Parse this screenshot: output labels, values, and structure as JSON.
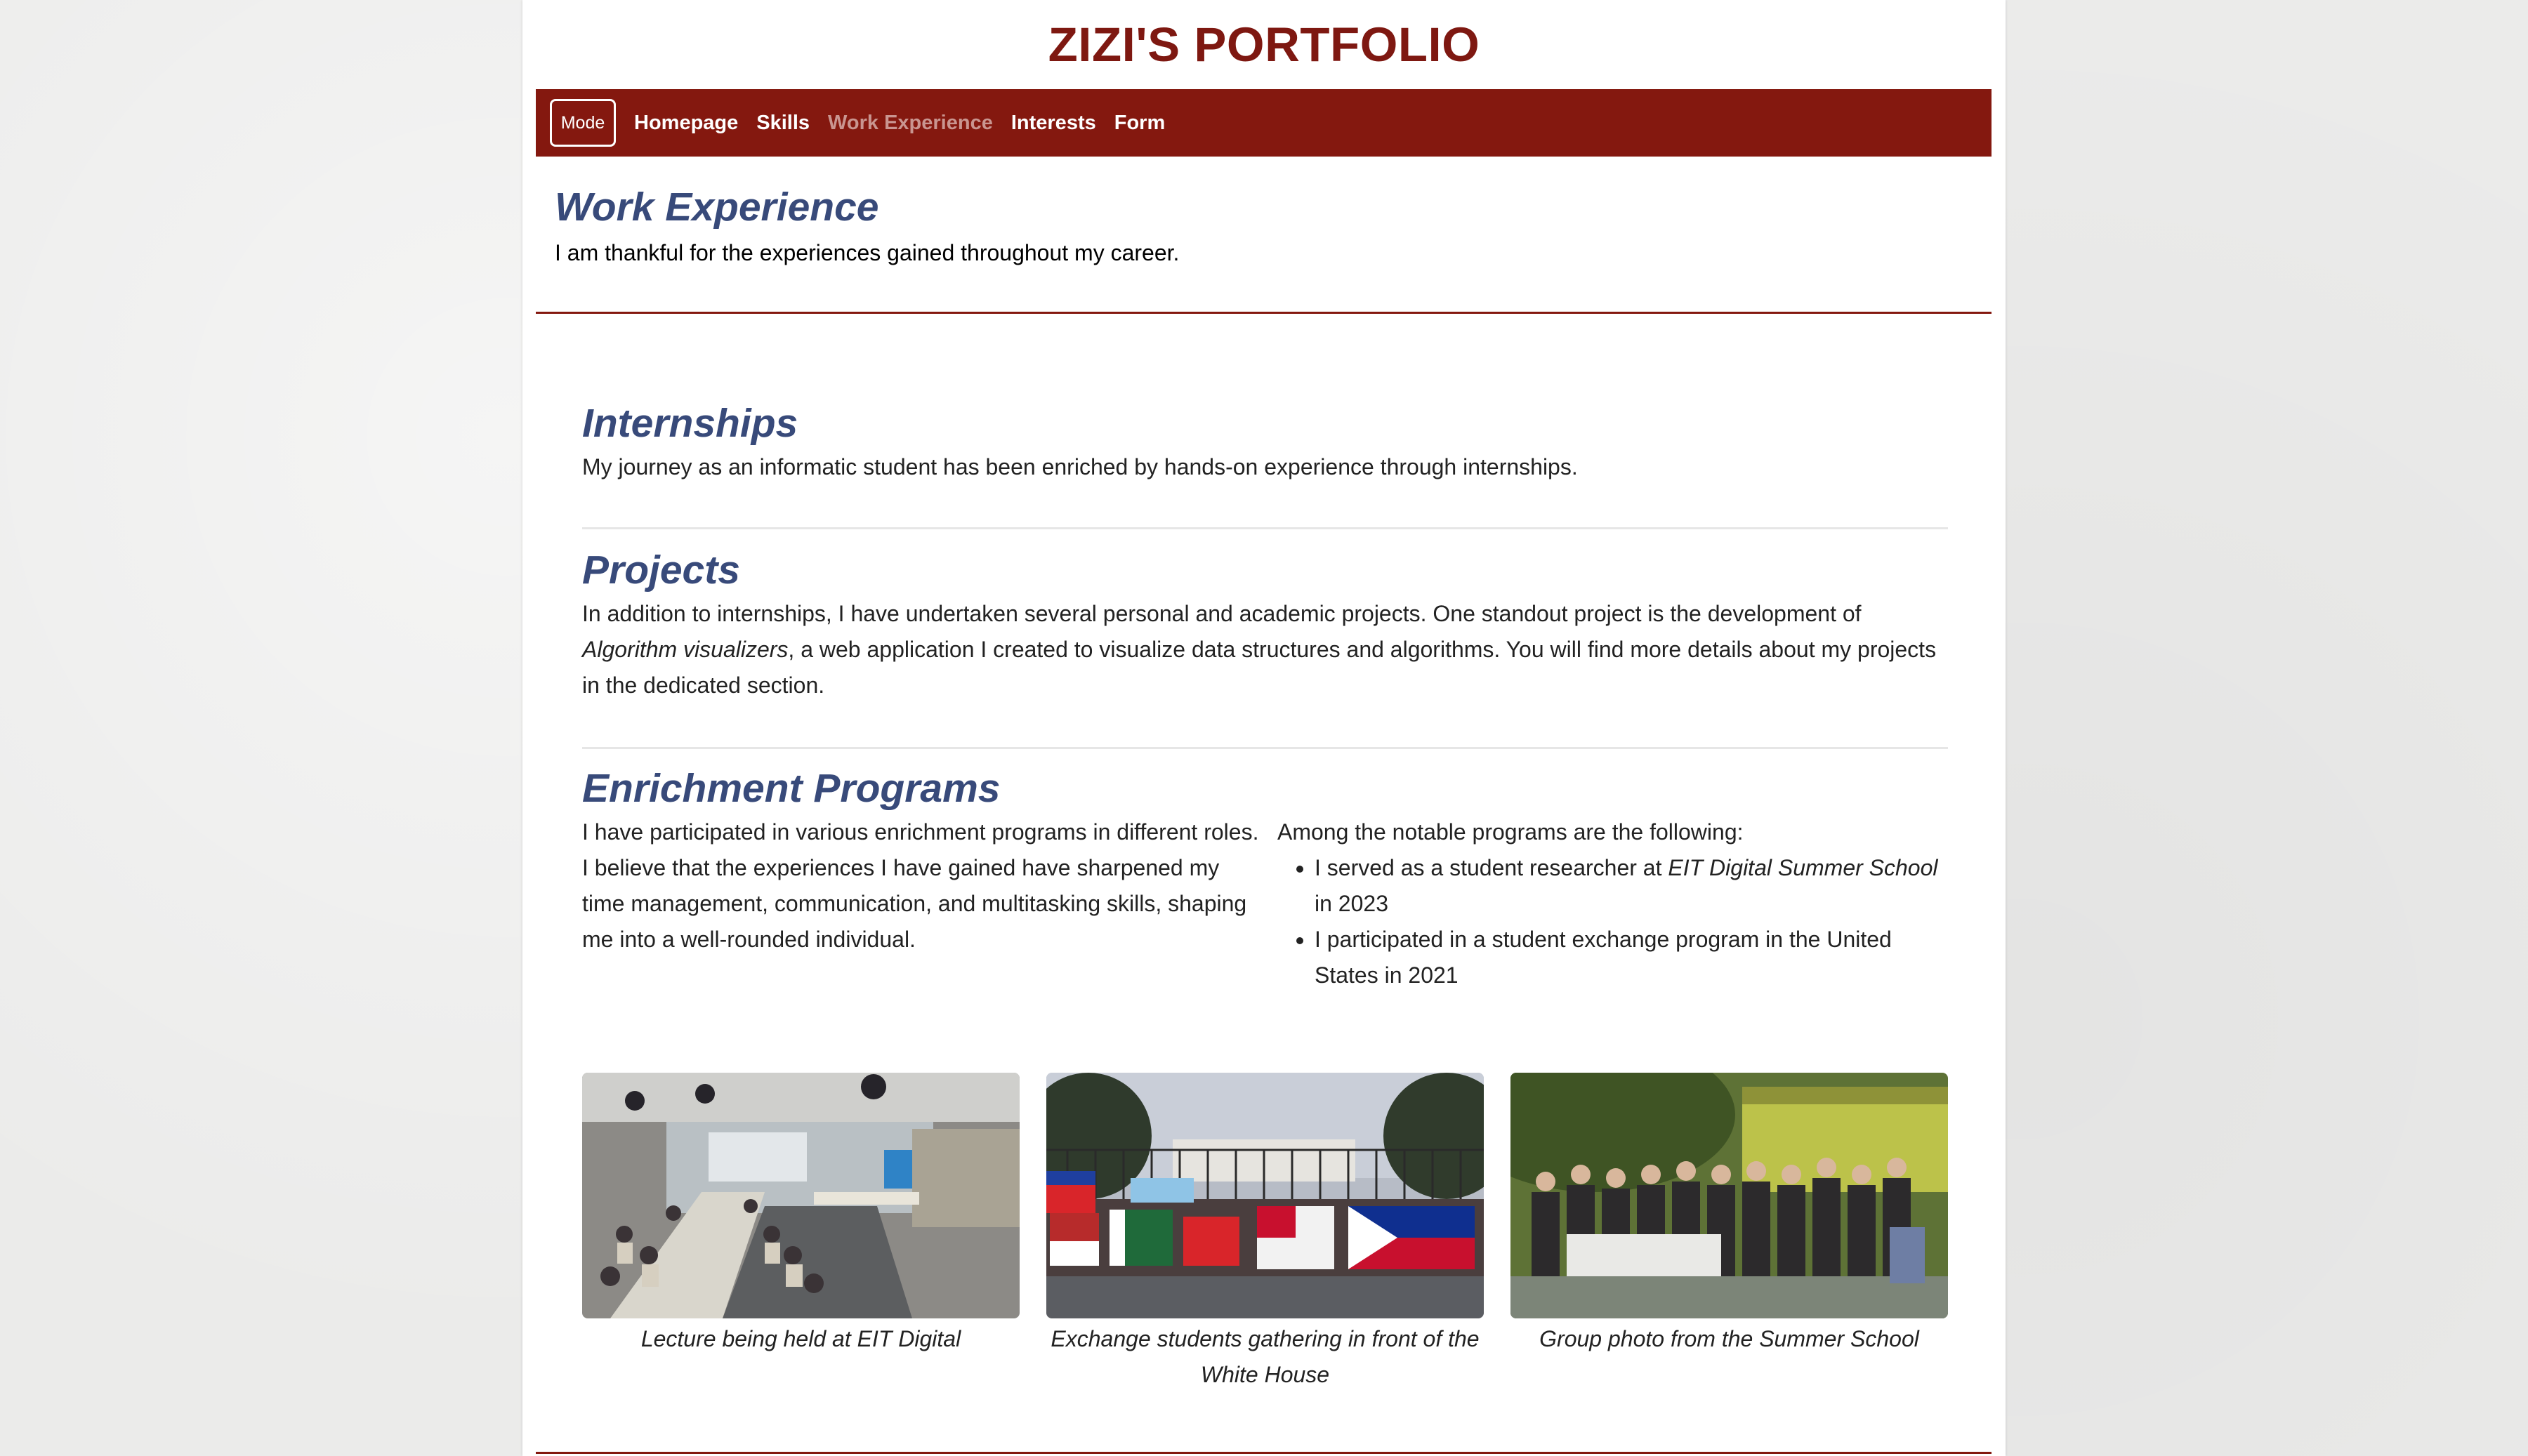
{
  "site": {
    "title": "ZIZI'S PORTFOLIO"
  },
  "nav": {
    "mode_label": "Mode",
    "links": [
      "Homepage",
      "Skills",
      "Work Experience",
      "Interests",
      "Form"
    ],
    "active": "Work Experience"
  },
  "intro": {
    "title": "Work Experience",
    "text": "I am thankful for the experiences gained throughout my career."
  },
  "internships": {
    "title": "Internships",
    "text": "My journey as an informatic student has been enriched by hands-on experience through internships."
  },
  "projects": {
    "title": "Projects",
    "text_before": "In addition to internships, I have undertaken several personal and academic projects. One standout project is the development of ",
    "highlight": "Algorithm visualizers",
    "text_after": ", a web application I created to visualize data structures and algorithms. You will find more details about my projects in the dedicated section."
  },
  "enrichment": {
    "title": "Enrichment Programs",
    "left_text": "I have participated in various enrichment programs in different roles. I believe that the experiences I have gained have sharpened my time management, communication, and multitasking skills, shaping me into a well-rounded individual.",
    "right_intro": "Among the notable programs are the following:",
    "items": [
      {
        "before": "I served as a student researcher at ",
        "em": "EIT Digital Summer School",
        "after": " in 2023"
      },
      {
        "before": "I participated in a student exchange program in the United States in 2021",
        "em": "",
        "after": ""
      }
    ]
  },
  "photos": [
    {
      "caption": "Lecture being held at EIT Digital"
    },
    {
      "caption": "Exchange students gathering in front of the White House"
    },
    {
      "caption": "Group photo from the Summer School"
    }
  ],
  "colors": {
    "brand_red": "#84180f",
    "title_red": "#7e1811",
    "heading_blue": "#384a7a",
    "nav_active": "#c99590"
  }
}
